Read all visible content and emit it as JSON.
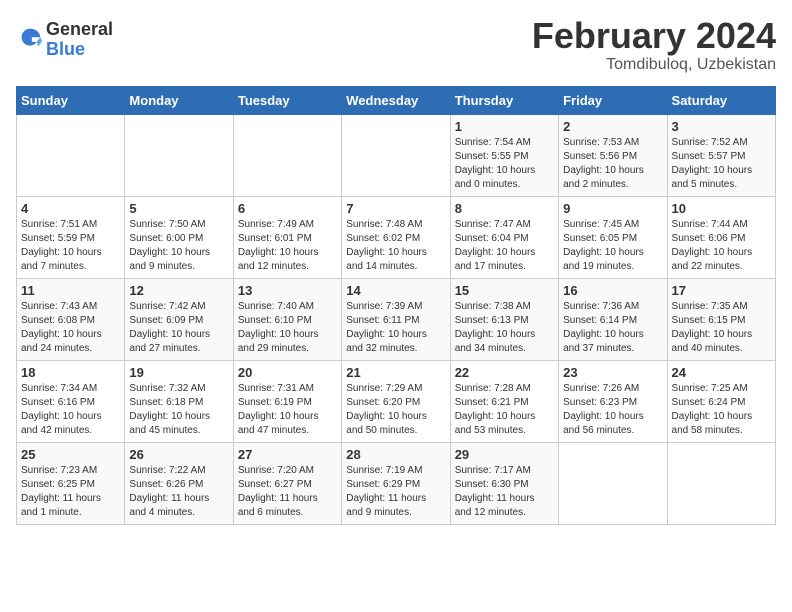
{
  "logo": {
    "general": "General",
    "blue": "Blue"
  },
  "title": {
    "month_year": "February 2024",
    "location": "Tomdibuloq, Uzbekistan"
  },
  "days_of_week": [
    "Sunday",
    "Monday",
    "Tuesday",
    "Wednesday",
    "Thursday",
    "Friday",
    "Saturday"
  ],
  "weeks": [
    [
      {
        "day": "",
        "info": ""
      },
      {
        "day": "",
        "info": ""
      },
      {
        "day": "",
        "info": ""
      },
      {
        "day": "",
        "info": ""
      },
      {
        "day": "1",
        "info": "Sunrise: 7:54 AM\nSunset: 5:55 PM\nDaylight: 10 hours\nand 0 minutes."
      },
      {
        "day": "2",
        "info": "Sunrise: 7:53 AM\nSunset: 5:56 PM\nDaylight: 10 hours\nand 2 minutes."
      },
      {
        "day": "3",
        "info": "Sunrise: 7:52 AM\nSunset: 5:57 PM\nDaylight: 10 hours\nand 5 minutes."
      }
    ],
    [
      {
        "day": "4",
        "info": "Sunrise: 7:51 AM\nSunset: 5:59 PM\nDaylight: 10 hours\nand 7 minutes."
      },
      {
        "day": "5",
        "info": "Sunrise: 7:50 AM\nSunset: 6:00 PM\nDaylight: 10 hours\nand 9 minutes."
      },
      {
        "day": "6",
        "info": "Sunrise: 7:49 AM\nSunset: 6:01 PM\nDaylight: 10 hours\nand 12 minutes."
      },
      {
        "day": "7",
        "info": "Sunrise: 7:48 AM\nSunset: 6:02 PM\nDaylight: 10 hours\nand 14 minutes."
      },
      {
        "day": "8",
        "info": "Sunrise: 7:47 AM\nSunset: 6:04 PM\nDaylight: 10 hours\nand 17 minutes."
      },
      {
        "day": "9",
        "info": "Sunrise: 7:45 AM\nSunset: 6:05 PM\nDaylight: 10 hours\nand 19 minutes."
      },
      {
        "day": "10",
        "info": "Sunrise: 7:44 AM\nSunset: 6:06 PM\nDaylight: 10 hours\nand 22 minutes."
      }
    ],
    [
      {
        "day": "11",
        "info": "Sunrise: 7:43 AM\nSunset: 6:08 PM\nDaylight: 10 hours\nand 24 minutes."
      },
      {
        "day": "12",
        "info": "Sunrise: 7:42 AM\nSunset: 6:09 PM\nDaylight: 10 hours\nand 27 minutes."
      },
      {
        "day": "13",
        "info": "Sunrise: 7:40 AM\nSunset: 6:10 PM\nDaylight: 10 hours\nand 29 minutes."
      },
      {
        "day": "14",
        "info": "Sunrise: 7:39 AM\nSunset: 6:11 PM\nDaylight: 10 hours\nand 32 minutes."
      },
      {
        "day": "15",
        "info": "Sunrise: 7:38 AM\nSunset: 6:13 PM\nDaylight: 10 hours\nand 34 minutes."
      },
      {
        "day": "16",
        "info": "Sunrise: 7:36 AM\nSunset: 6:14 PM\nDaylight: 10 hours\nand 37 minutes."
      },
      {
        "day": "17",
        "info": "Sunrise: 7:35 AM\nSunset: 6:15 PM\nDaylight: 10 hours\nand 40 minutes."
      }
    ],
    [
      {
        "day": "18",
        "info": "Sunrise: 7:34 AM\nSunset: 6:16 PM\nDaylight: 10 hours\nand 42 minutes."
      },
      {
        "day": "19",
        "info": "Sunrise: 7:32 AM\nSunset: 6:18 PM\nDaylight: 10 hours\nand 45 minutes."
      },
      {
        "day": "20",
        "info": "Sunrise: 7:31 AM\nSunset: 6:19 PM\nDaylight: 10 hours\nand 47 minutes."
      },
      {
        "day": "21",
        "info": "Sunrise: 7:29 AM\nSunset: 6:20 PM\nDaylight: 10 hours\nand 50 minutes."
      },
      {
        "day": "22",
        "info": "Sunrise: 7:28 AM\nSunset: 6:21 PM\nDaylight: 10 hours\nand 53 minutes."
      },
      {
        "day": "23",
        "info": "Sunrise: 7:26 AM\nSunset: 6:23 PM\nDaylight: 10 hours\nand 56 minutes."
      },
      {
        "day": "24",
        "info": "Sunrise: 7:25 AM\nSunset: 6:24 PM\nDaylight: 10 hours\nand 58 minutes."
      }
    ],
    [
      {
        "day": "25",
        "info": "Sunrise: 7:23 AM\nSunset: 6:25 PM\nDaylight: 11 hours\nand 1 minute."
      },
      {
        "day": "26",
        "info": "Sunrise: 7:22 AM\nSunset: 6:26 PM\nDaylight: 11 hours\nand 4 minutes."
      },
      {
        "day": "27",
        "info": "Sunrise: 7:20 AM\nSunset: 6:27 PM\nDaylight: 11 hours\nand 6 minutes."
      },
      {
        "day": "28",
        "info": "Sunrise: 7:19 AM\nSunset: 6:29 PM\nDaylight: 11 hours\nand 9 minutes."
      },
      {
        "day": "29",
        "info": "Sunrise: 7:17 AM\nSunset: 6:30 PM\nDaylight: 11 hours\nand 12 minutes."
      },
      {
        "day": "",
        "info": ""
      },
      {
        "day": "",
        "info": ""
      }
    ]
  ]
}
